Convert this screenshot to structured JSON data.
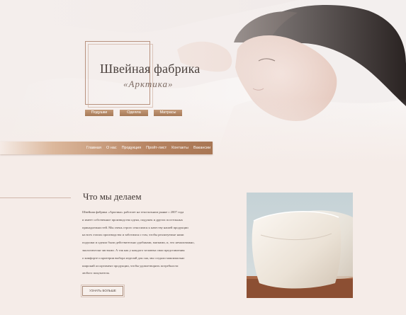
{
  "header": {
    "title": "Швейная фабрика",
    "subtitle": "«Арктика»",
    "categories": [
      "Подушки",
      "Одеяла",
      "Матрасы"
    ]
  },
  "nav": {
    "items": [
      "Главная",
      "О нас",
      "Продукция",
      "Пройт-лист",
      "Контакты",
      "Вакансии"
    ]
  },
  "section": {
    "title": "Что мы делаем",
    "lines": [
      "Швейная фабрика «Арктика» работает на текстильном рынке с 2007 года",
      "и имеет собственное производство одеял, подушек и других постельных",
      "принадлежностей. Мы очень строго относимся к качеству нашей продукции",
      "на всех этапах производства и заботимся о том, чтобы реализуемые нами",
      "подушки и одеяла были действительно удобными, мягкими, и, что немаловажно,",
      "экологически чистыми. А так как у каждого человека свои представления",
      "о комфорте и критерии выбора изделий для сна, мы создали максимально",
      "широкий ассортимент продукции, чтобы удовлетворить потребности",
      "любого покупателя."
    ],
    "more_label": "УЗНАТЬ БОЛЬШЕ"
  },
  "colors": {
    "accent": "#a87654",
    "background": "#f5ece8"
  }
}
